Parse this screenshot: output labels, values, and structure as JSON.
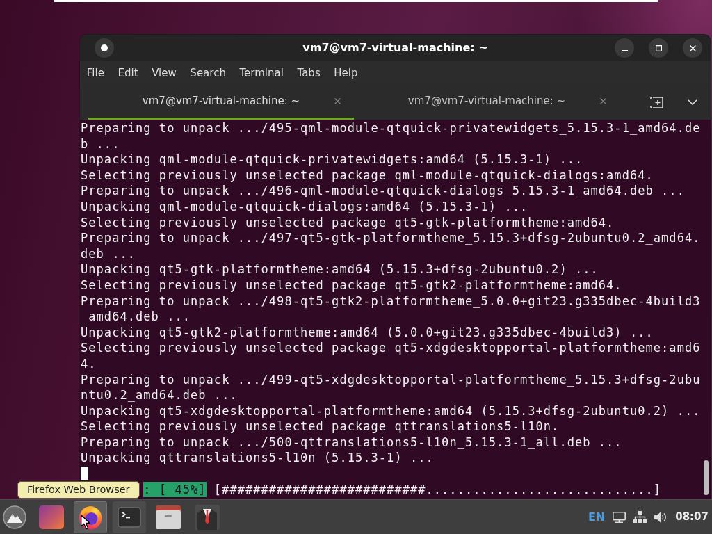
{
  "window": {
    "title": "vm7@vm7-virtual-machine: ~"
  },
  "menu": [
    "File",
    "Edit",
    "View",
    "Search",
    "Terminal",
    "Tabs",
    "Help"
  ],
  "tabs": [
    {
      "label": "vm7@vm7-virtual-machine: ~",
      "selected": true
    },
    {
      "label": "vm7@vm7-virtual-machine: ~",
      "selected": false
    }
  ],
  "terminal": {
    "lines": [
      "Preparing to unpack .../495-qml-module-qtquick-privatewidgets_5.15.3-1_amd64.de",
      "b ...",
      "Unpacking qml-module-qtquick-privatewidgets:amd64 (5.15.3-1) ...",
      "Selecting previously unselected package qml-module-qtquick-dialogs:amd64.",
      "Preparing to unpack .../496-qml-module-qtquick-dialogs_5.15.3-1_amd64.deb ...",
      "Unpacking qml-module-qtquick-dialogs:amd64 (5.15.3-1) ...",
      "Selecting previously unselected package qt5-gtk-platformtheme:amd64.",
      "Preparing to unpack .../497-qt5-gtk-platformtheme_5.15.3+dfsg-2ubuntu0.2_amd64.",
      "deb ...",
      "Unpacking qt5-gtk-platformtheme:amd64 (5.15.3+dfsg-2ubuntu0.2) ...",
      "Selecting previously unselected package qt5-gtk2-platformtheme:amd64.",
      "Preparing to unpack .../498-qt5-gtk2-platformtheme_5.0.0+git23.g335dbec-4build3",
      "_amd64.deb ...",
      "Unpacking qt5-gtk2-platformtheme:amd64 (5.0.0+git23.g335dbec-4build3) ...",
      "Selecting previously unselected package qt5-xdgdesktopportal-platformtheme:amd6",
      "4.",
      "Preparing to unpack .../499-qt5-xdgdesktopportal-platformtheme_5.15.3+dfsg-2ubu",
      "ntu0.2_amd64.deb ...",
      "Unpacking qt5-xdgdesktopportal-platformtheme:amd64 (5.15.3+dfsg-2ubuntu0.2) ...",
      "Selecting previously unselected package qttranslations5-l10n.",
      "Preparing to unpack .../500-qttranslations5-l10n_5.15.3-1_all.deb ...",
      "Unpacking qttranslations5-l10n (5.15.3-1) ..."
    ],
    "cursor": true,
    "progress": {
      "label": ": [ 45%]",
      "bar": "[##########################.............................]"
    }
  },
  "tooltip": "Firefox Web Browser",
  "taskbar": {
    "apps": [
      {
        "kind": "logo",
        "hovered": false,
        "active": false
      },
      {
        "kind": "tile",
        "hovered": false,
        "active": false
      },
      {
        "kind": "browser",
        "hovered": true,
        "active": false
      },
      {
        "kind": "terminal",
        "hovered": false,
        "active": true
      },
      {
        "kind": "files",
        "hovered": false,
        "active": false
      },
      {
        "kind": "suit",
        "hovered": false,
        "active": false
      }
    ],
    "language": "EN",
    "clock": "08:07"
  }
}
